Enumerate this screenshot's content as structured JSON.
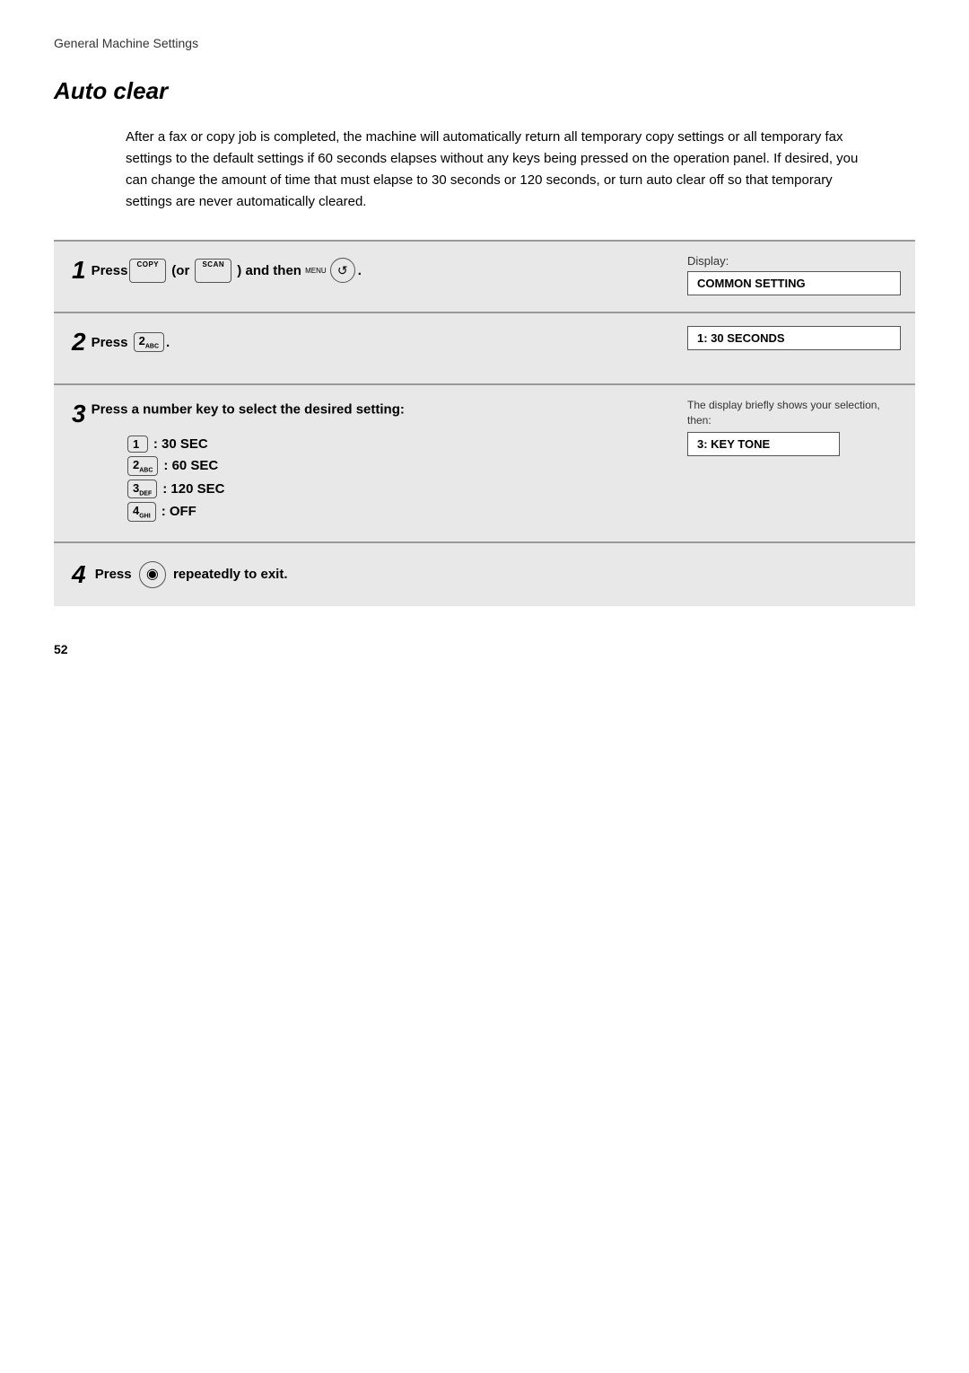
{
  "breadcrumb": "General Machine Settings",
  "title": "Auto clear",
  "intro": "After a fax or copy job is completed, the machine will automatically return all temporary copy settings or all temporary fax settings to the default settings if 60 seconds elapses without any keys being pressed on the operation panel. If desired, you can change the amount of time that must elapse to 30 seconds or 120 seconds, or turn auto clear off so that temporary settings are never automatically cleared.",
  "steps": [
    {
      "number": "1",
      "instruction": "Press  (or  ) and then  .",
      "display_label": "Display:",
      "display_value": "COMMON SETTING"
    },
    {
      "number": "2",
      "instruction": "Press 2.",
      "display_value": "1: 30 SECONDS"
    },
    {
      "number": "3",
      "instruction": "Press a number key to select the desired setting:",
      "options": [
        {
          "key": "1",
          "sub": "",
          "text": ": 30 SEC"
        },
        {
          "key": "2",
          "sub": "ABC",
          "text": ": 60 SEC"
        },
        {
          "key": "3",
          "sub": "DEF",
          "text": ": 120 SEC"
        },
        {
          "key": "4",
          "sub": "GHI",
          "text": ": OFF"
        }
      ],
      "display_note": "The display briefly shows your selection, then:",
      "display_value": "3: KEY TONE"
    },
    {
      "number": "4",
      "instruction": "Press  repeatedly to exit."
    }
  ],
  "page_number": "52",
  "keys": {
    "copy_label": "COPY",
    "scan_label": "SCAN",
    "menu_label": "MENU"
  }
}
